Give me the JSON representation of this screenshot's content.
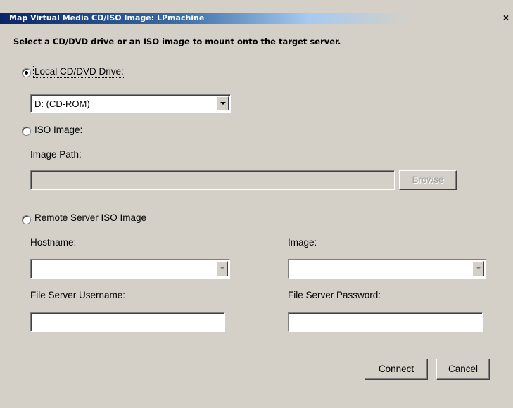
{
  "window": {
    "title": "Map Virtual Media CD/ISO Image: LPmachine",
    "close_glyph": "×"
  },
  "instruction": "Select a CD/DVD drive or an ISO image to mount onto the target server.",
  "local_drive": {
    "label": "Local CD/DVD Drive:",
    "selected": true,
    "value": "D: (CD-ROM)"
  },
  "iso_image": {
    "label": "ISO Image:",
    "selected": false,
    "path_label": "Image Path:",
    "path_value": "",
    "browse_label": "Browse"
  },
  "remote": {
    "label": "Remote Server ISO Image",
    "selected": false,
    "hostname_label": "Hostname:",
    "hostname_value": "",
    "image_label": "Image:",
    "image_value": "",
    "username_label": "File Server Username:",
    "username_value": "",
    "password_label": "File Server Password:",
    "password_value": ""
  },
  "buttons": {
    "connect": "Connect",
    "cancel": "Cancel"
  },
  "colors": {
    "dialog_bg": "#d4d0c8",
    "title_bar": "#0a246a"
  }
}
